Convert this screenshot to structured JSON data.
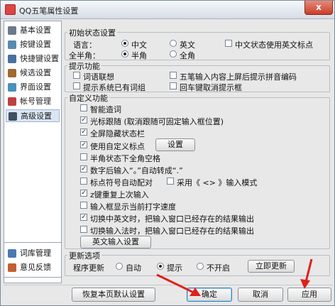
{
  "window": {
    "title": "QQ五笔属性设置",
    "close_label": "x"
  },
  "sidebar": {
    "items": [
      {
        "label": "基本设置",
        "icon": "wrench-icon",
        "color": "#6a7a8a"
      },
      {
        "label": "按键设置",
        "icon": "keyboard-icon",
        "color": "#5a8ab0"
      },
      {
        "label": "快捷键设置",
        "icon": "shortcut-icon",
        "color": "#4a70a0"
      },
      {
        "label": "候选设置",
        "icon": "candidate-icon",
        "color": "#a06a30"
      },
      {
        "label": "界面设置",
        "icon": "display-icon",
        "color": "#4a90c0"
      },
      {
        "label": "帐号管理",
        "icon": "account-icon",
        "color": "#c04040"
      },
      {
        "label": "高级设置",
        "icon": "advanced-icon",
        "color": "#405060"
      }
    ],
    "selected_index": 6,
    "tools": [
      {
        "label": "词库管理",
        "icon": "dictionary-icon",
        "color": "#4a7ab0"
      },
      {
        "label": "意见反馈",
        "icon": "feedback-icon",
        "color": "#c06030"
      }
    ]
  },
  "initial": {
    "title": "初始状态设置",
    "language_label": "语言：",
    "lang_options": [
      "中文",
      "英文"
    ],
    "lang_selected": 0,
    "cn_punct_en_label": "中文状态使用英文标点",
    "width_label": "全半角：",
    "width_options": [
      "半角",
      "全角"
    ],
    "width_selected": 0
  },
  "hint": {
    "title": "提示功能",
    "items": [
      {
        "label": "词语联想",
        "checked": false
      },
      {
        "label": "五笔输入内容上屏后提示拼音编码",
        "checked": false
      },
      {
        "label": "提示系统已有词组",
        "checked": false
      },
      {
        "label": "回车键取消提示框",
        "checked": false
      }
    ]
  },
  "custom": {
    "title": "自定义功能",
    "items": [
      {
        "label": "智能造词",
        "checked": false
      },
      {
        "label": "光标跟随 (取消跟随可固定输入框位置)",
        "checked": true
      },
      {
        "label": "全屏隐藏状态栏",
        "checked": true
      },
      {
        "label": "使用自定义标点",
        "checked": true
      },
      {
        "label": "半角状态下全角空格",
        "checked": false
      },
      {
        "label": "数字后输入“。”自动转成“.”",
        "checked": true
      },
      {
        "label": "标点符号自动配对",
        "checked": false
      },
      {
        "label": "采用《 <> 》输入模式",
        "checked": false
      },
      {
        "label": "z键重复上次输入",
        "checked": true
      },
      {
        "label": "输入框显示当前打字速度",
        "checked": false
      },
      {
        "label": "切换中英文时，把输入窗口已经存在的结果输出",
        "checked": true
      },
      {
        "label": "切换输入法时，把输入窗口已经存在的结果输出",
        "checked": false
      }
    ],
    "setting_button": "设置",
    "english_button": "英文输入设置"
  },
  "update": {
    "title": "更新选项",
    "label": "程序更新",
    "options": [
      "自动",
      "提示",
      "不开启"
    ],
    "selected": 1,
    "update_now_button": "立即更新"
  },
  "footer": {
    "restore_button": "恢复本页默认设置",
    "ok_button": "确定",
    "cancel_button": "取消",
    "apply_button": "应用"
  },
  "colors": {
    "arrow": "#e0201a",
    "accent": "#3c7fb1"
  }
}
